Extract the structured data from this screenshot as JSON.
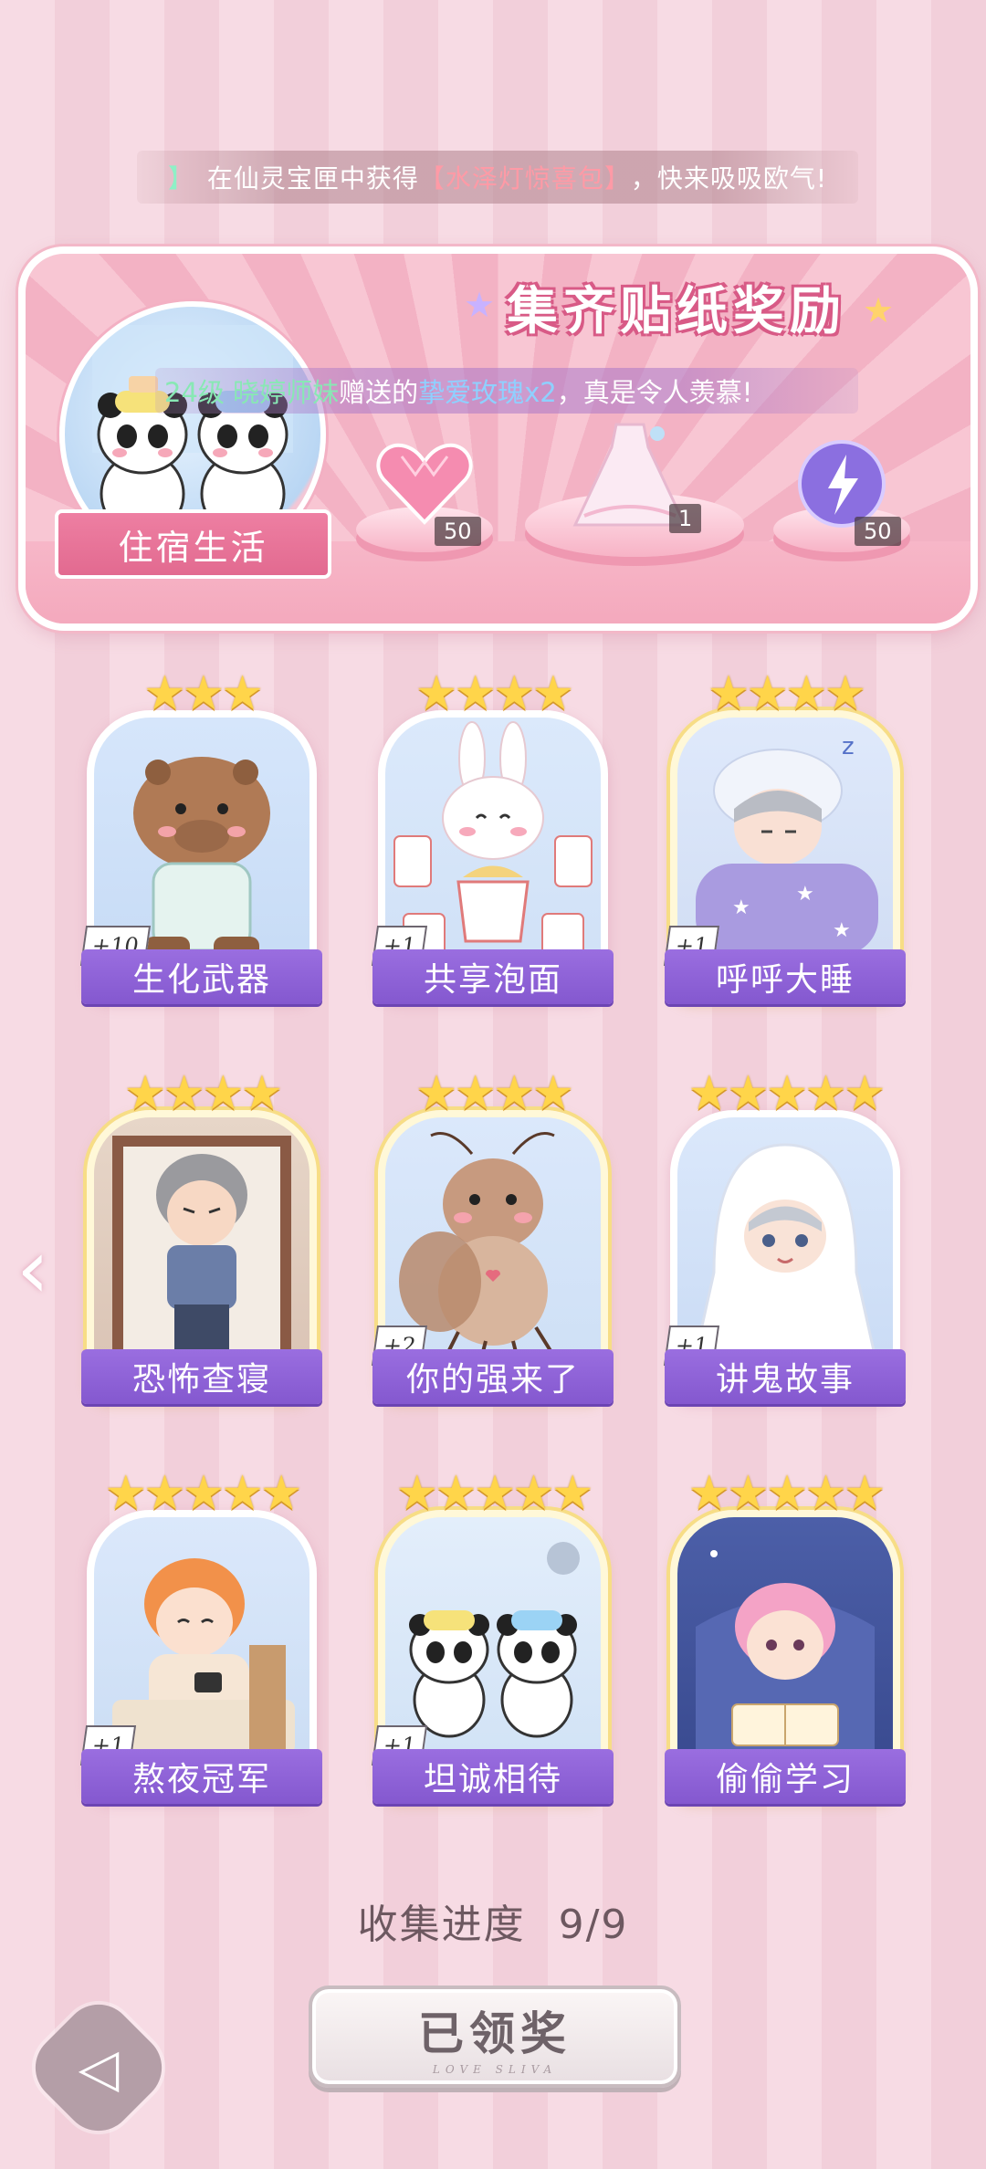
{
  "marquee": {
    "prefix": "】",
    "text": "在仙灵宝匣中获得",
    "item": "【水泽灯惊喜包】",
    "suffix": "，快来吸吸欧气!"
  },
  "reward_panel": {
    "title": "集齐贴纸奖励",
    "gift_message": {
      "sender": "24级 晓婷师妹",
      "middle": "赠送的",
      "item": "挚爱玫瑰x2",
      "suffix": "，真是令人羡慕!"
    },
    "badge_label": "住宿生活",
    "rewards": [
      {
        "name": "heart-gem",
        "count": "50"
      },
      {
        "name": "dress",
        "count": "1"
      },
      {
        "name": "energy-orb",
        "count": "50"
      }
    ]
  },
  "stickers": [
    {
      "label": "生化武器",
      "count": "+10",
      "stars": 3,
      "frame": "white"
    },
    {
      "label": "共享泡面",
      "count": "+1",
      "stars": 4,
      "frame": "white"
    },
    {
      "label": "呼呼大睡",
      "count": "+1",
      "stars": 4,
      "frame": "gold"
    },
    {
      "label": "恐怖查寝",
      "count": "",
      "stars": 4,
      "frame": "gold"
    },
    {
      "label": "你的强来了",
      "count": "+2",
      "stars": 4,
      "frame": "gold"
    },
    {
      "label": "讲鬼故事",
      "count": "+1",
      "stars": 5,
      "frame": "white"
    },
    {
      "label": "熬夜冠军",
      "count": "+1",
      "stars": 5,
      "frame": "white"
    },
    {
      "label": "坦诚相待",
      "count": "+1",
      "stars": 5,
      "frame": "gold"
    },
    {
      "label": "偷偷学习",
      "count": "",
      "stars": 5,
      "frame": "gold"
    }
  ],
  "progress": {
    "label": "收集进度",
    "value": "9/9"
  },
  "claim_button": {
    "label": "已领奖",
    "sub": "LOVE SLIVA"
  },
  "colors": {
    "label_purple": "#8a5fd4",
    "pink_panel": "#f5b3c6",
    "gold_star": "#ffd54a"
  }
}
